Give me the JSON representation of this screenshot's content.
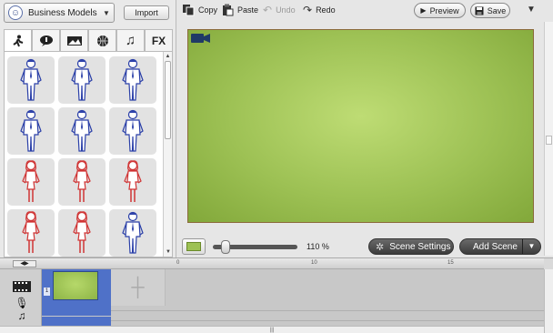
{
  "theme": {
    "label": "Business Models",
    "caret": "▼"
  },
  "import_label": "Import",
  "categories": [
    {
      "name": "characters",
      "glyph": "🏃"
    },
    {
      "name": "bubbles",
      "glyph": "💬"
    },
    {
      "name": "backgrounds",
      "glyph": "🖼"
    },
    {
      "name": "props",
      "glyph": "⚽"
    },
    {
      "name": "sounds",
      "glyph": "♫"
    },
    {
      "name": "effects",
      "glyph": "FX"
    }
  ],
  "library": {
    "characters": [
      {
        "gender": "male"
      },
      {
        "gender": "male"
      },
      {
        "gender": "male"
      },
      {
        "gender": "male"
      },
      {
        "gender": "male"
      },
      {
        "gender": "male"
      },
      {
        "gender": "female"
      },
      {
        "gender": "female"
      },
      {
        "gender": "female"
      },
      {
        "gender": "female"
      },
      {
        "gender": "female"
      },
      {
        "gender": "male"
      }
    ],
    "male_color": "#2a3fa8",
    "female_color": "#d03434"
  },
  "toolbar": {
    "copy": "Copy",
    "paste": "Paste",
    "undo": "Undo",
    "redo": "Redo",
    "preview": "Preview",
    "save": "Save"
  },
  "stage": {
    "background_color": "#9dc154"
  },
  "zoom": {
    "label": "110 %",
    "level_percent": 110
  },
  "scene_settings_label": "Scene Settings",
  "add_scene_label": "Add Scene",
  "timeline": {
    "ruler_ticks": [
      "0",
      "10",
      "15"
    ],
    "scene_number": "1"
  }
}
